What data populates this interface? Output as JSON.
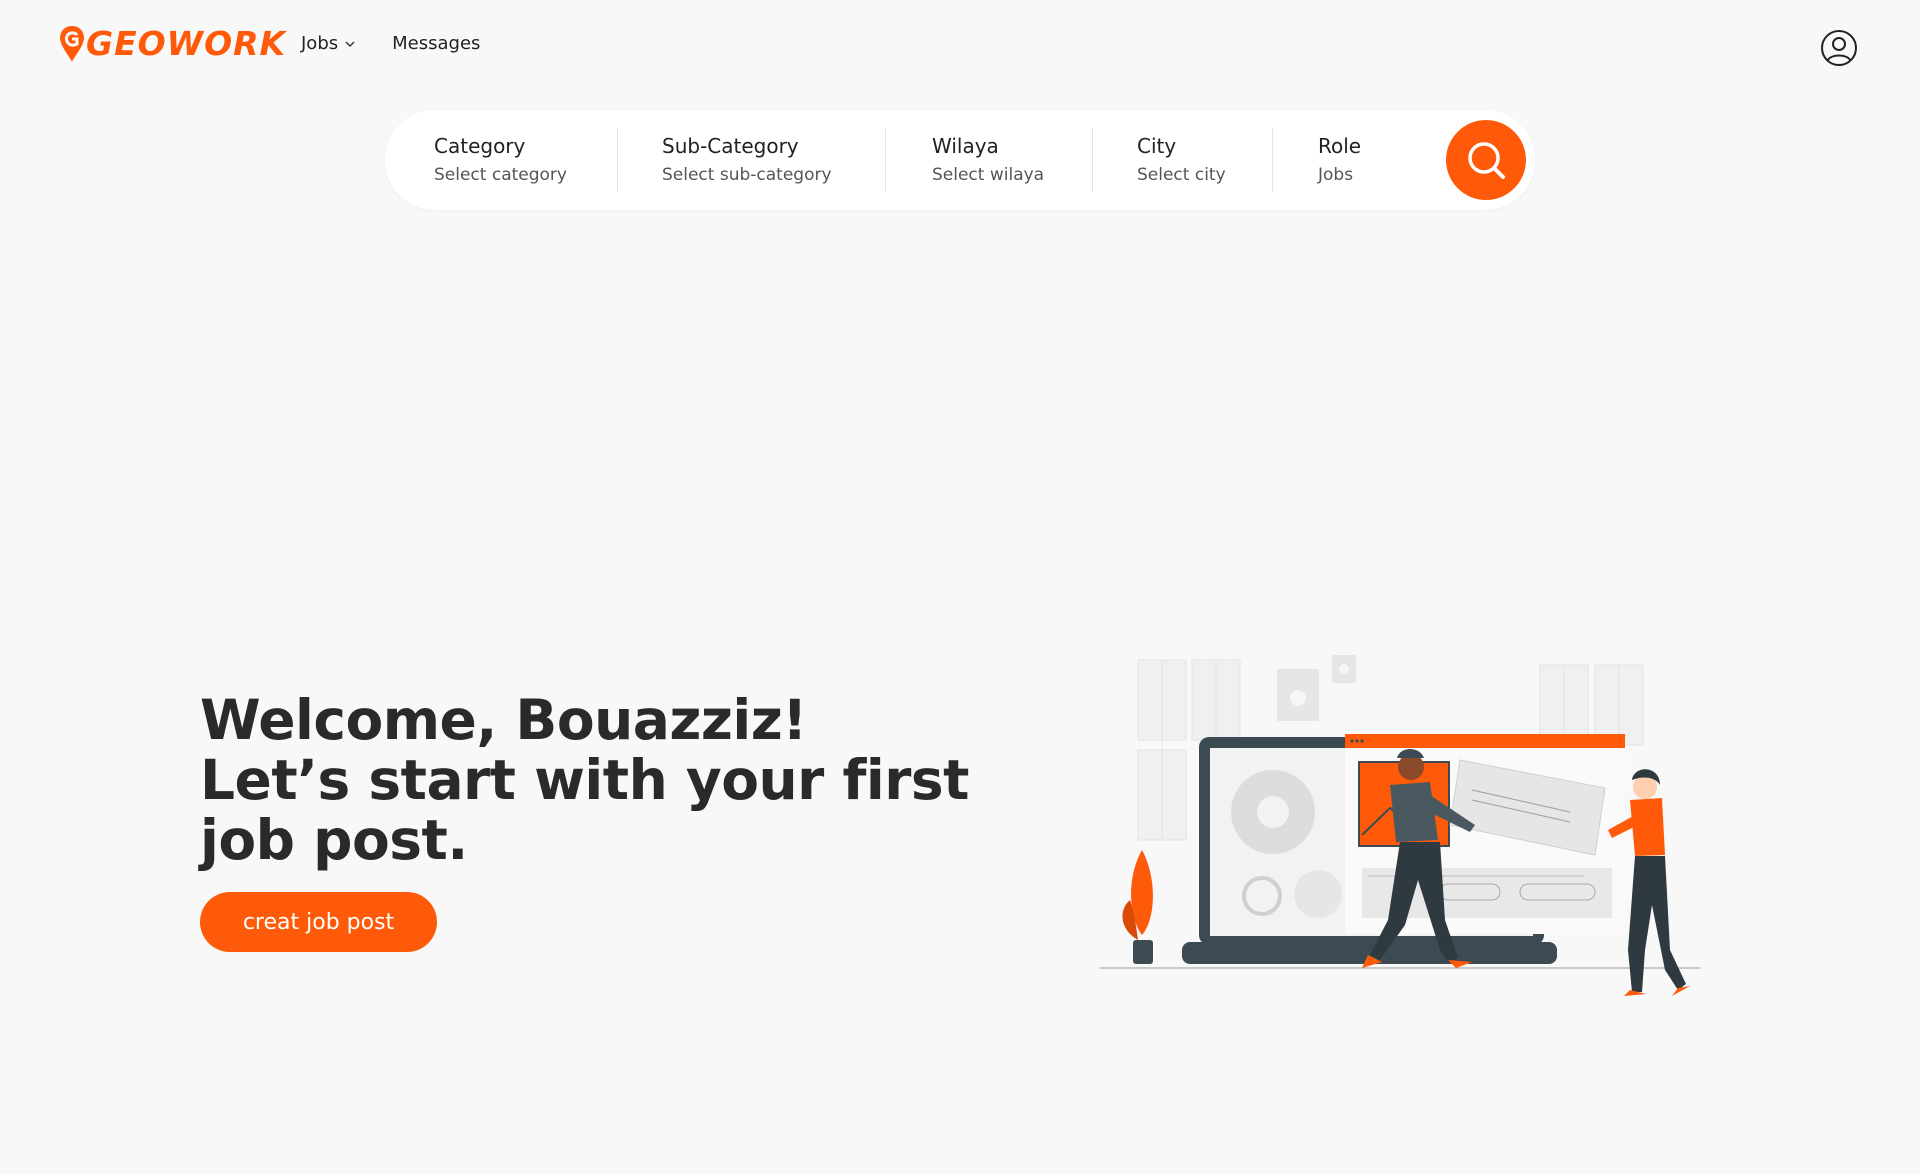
{
  "brand": {
    "logo_text": "GEOWORK",
    "accent_color": "#ff5a0a"
  },
  "nav": {
    "jobs_label": "Jobs",
    "messages_label": "Messages"
  },
  "search": {
    "category": {
      "label": "Category",
      "value": "Select category"
    },
    "subcategory": {
      "label": "Sub-Category",
      "value": "Select sub-category"
    },
    "wilaya": {
      "label": "Wilaya",
      "value": "Select wilaya"
    },
    "city": {
      "label": "City",
      "value": "Select city"
    },
    "role": {
      "label": "Role",
      "value": "Jobs"
    },
    "button_icon": "search-icon"
  },
  "hero": {
    "line1": "Welcome, Bouazziz!",
    "line2": "Let’s start with your first",
    "line3": "job post.",
    "cta_label": "creat job post"
  },
  "icons": {
    "user": "user-circle-icon",
    "chevron": "chevron-down-icon"
  }
}
